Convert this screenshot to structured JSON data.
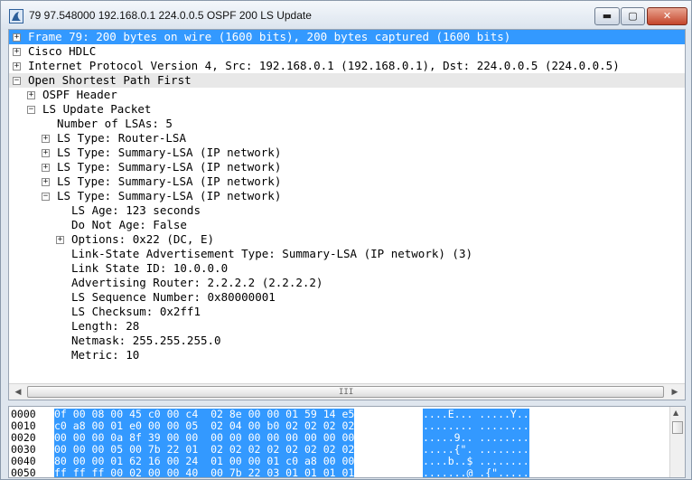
{
  "window": {
    "title": "79 97.548000 192.168.0.1 224.0.0.5 OSPF 200 LS Update",
    "buttons": {
      "minimize": "▬",
      "maximize": "▢",
      "close": "✕"
    }
  },
  "tree": [
    {
      "exp": "+",
      "text": "Frame 79: 200 bytes on wire (1600 bits), 200 bytes captured (1600 bits)"
    },
    {
      "exp": "+",
      "text": "Cisco HDLC"
    },
    {
      "exp": "+",
      "text": "Internet Protocol Version 4, Src: 192.168.0.1 (192.168.0.1), Dst: 224.0.0.5 (224.0.0.5)"
    },
    {
      "exp": "−",
      "text": "Open Shortest Path First"
    },
    {
      "exp": "+",
      "text": "OSPF Header"
    },
    {
      "exp": "−",
      "text": "LS Update Packet"
    },
    {
      "exp": "",
      "text": "Number of LSAs: 5"
    },
    {
      "exp": "+",
      "text": "LS Type: Router-LSA"
    },
    {
      "exp": "+",
      "text": "LS Type: Summary-LSA (IP network)"
    },
    {
      "exp": "+",
      "text": "LS Type: Summary-LSA (IP network)"
    },
    {
      "exp": "+",
      "text": "LS Type: Summary-LSA (IP network)"
    },
    {
      "exp": "−",
      "text": "LS Type: Summary-LSA (IP network)"
    },
    {
      "exp": "",
      "text": "LS Age: 123 seconds"
    },
    {
      "exp": "",
      "text": "Do Not Age: False"
    },
    {
      "exp": "+",
      "text": "Options: 0x22 (DC, E)"
    },
    {
      "exp": "",
      "text": "Link-State Advertisement Type: Summary-LSA (IP network) (3)"
    },
    {
      "exp": "",
      "text": "Link State ID: 10.0.0.0"
    },
    {
      "exp": "",
      "text": "Advertising Router: 2.2.2.2 (2.2.2.2)"
    },
    {
      "exp": "",
      "text": "LS Sequence Number: 0x80000001"
    },
    {
      "exp": "",
      "text": "LS Checksum: 0x2ff1"
    },
    {
      "exp": "",
      "text": "Length: 28"
    },
    {
      "exp": "",
      "text": "Netmask: 255.255.255.0"
    },
    {
      "exp": "",
      "text": "Metric: 10"
    }
  ],
  "hscroll": {
    "grip": "III"
  },
  "hex": [
    {
      "off": "0000",
      "hex": "0f 00 08 00 45 c0 00 c4  02 8e 00 00 01 59 14 e5",
      "asc": "....E... .....Y.."
    },
    {
      "off": "0010",
      "hex": "c0 a8 00 01 e0 00 00 05  02 04 00 b0 02 02 02 02",
      "asc": "........ ........"
    },
    {
      "off": "0020",
      "hex": "00 00 00 0a 8f 39 00 00  00 00 00 00 00 00 00 00",
      "asc": ".....9.. ........"
    },
    {
      "off": "0030",
      "hex": "00 00 00 05 00 7b 22 01  02 02 02 02 02 02 02 02",
      "asc": ".....{\". ........"
    },
    {
      "off": "0040",
      "hex": "80 00 00 01 62 16 00 24  01 00 00 01 c0 a8 00 00",
      "asc": "....b..$ ........"
    },
    {
      "off": "0050",
      "hex": "ff ff ff 00 02 00 00 40  00 7b 22 03 01 01 01 01",
      "asc": ".......@ .{\"....."
    }
  ]
}
